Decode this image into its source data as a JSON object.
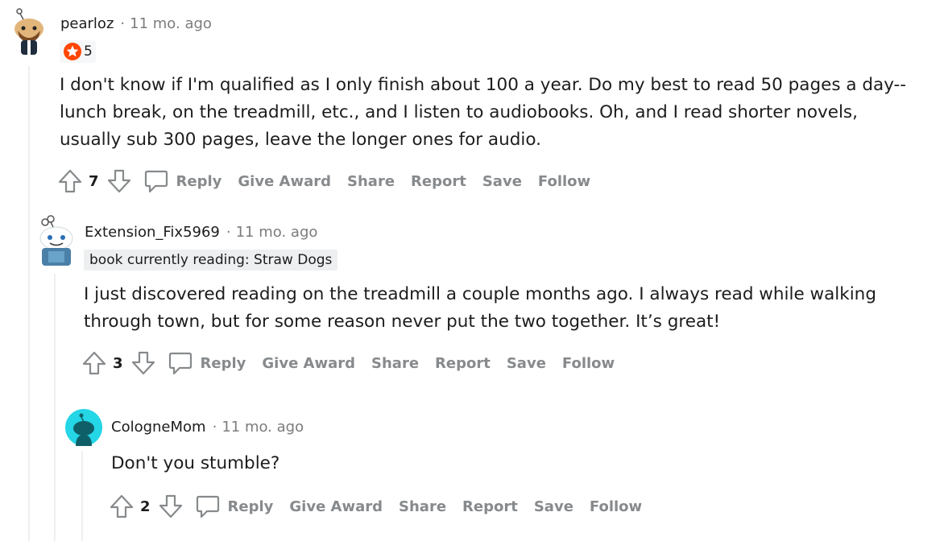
{
  "comments": [
    {
      "username": "pearloz",
      "separator": "·",
      "time": "11 mo. ago",
      "badge_value": "5",
      "body": [
        "I don't know if I'm qualified as I only finish about 100 a year. Do my best to read 50 pages a day--",
        "lunch break, on the treadmill, etc., and I listen to audiobooks. Oh, and I read shorter novels,",
        "usually sub 300 pages, leave the longer ones for audio."
      ],
      "score": "7"
    },
    {
      "username": "Extension_Fix5969",
      "separator": "·",
      "time": "11 mo. ago",
      "flair": "book currently reading: Straw Dogs",
      "body": [
        "I just discovered reading on the treadmill a couple months ago. I always read while walking",
        "through town, but for some reason never put the two together. It’s great!"
      ],
      "score": "3"
    },
    {
      "username": "CologneMom",
      "separator": "·",
      "time": "11 mo. ago",
      "body": [
        "Don't you stumble?"
      ],
      "score": "2"
    }
  ],
  "actions": {
    "reply": "Reply",
    "give_award": "Give Award",
    "share": "Share",
    "report": "Report",
    "save": "Save",
    "follow": "Follow"
  },
  "colors": {
    "meta_gray": "#7c7c7c",
    "action_gray": "#878a8c",
    "thread_line": "#edeff1",
    "badge_red": "#ff4500",
    "avatar_teal": "#24d6e6"
  }
}
